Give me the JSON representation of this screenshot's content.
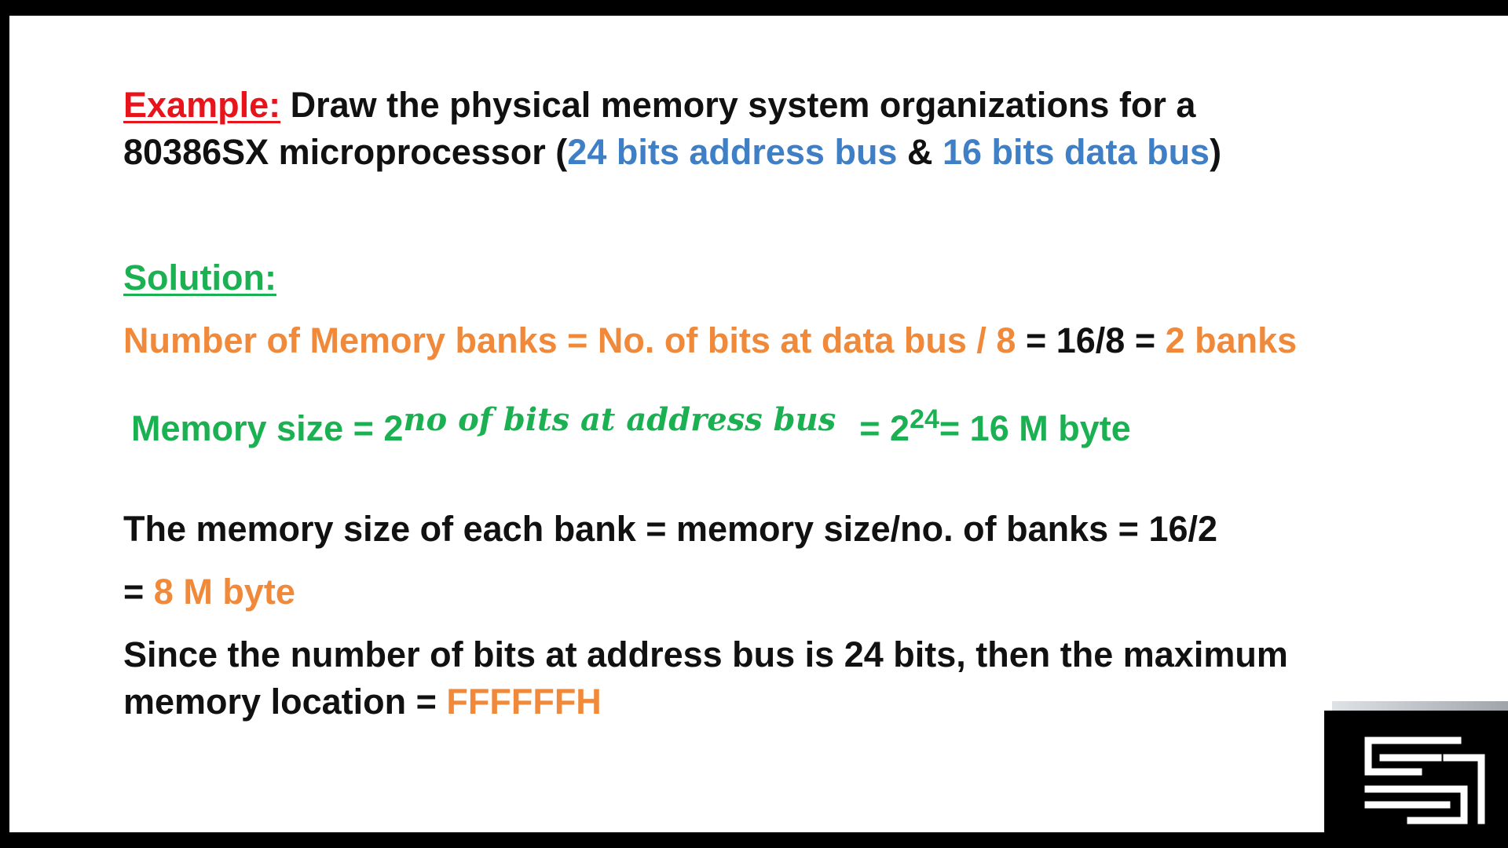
{
  "example": {
    "label": "Example:",
    "text1": " Draw the physical memory system organizations for a",
    "text2a": "80386SX microprocessor (",
    "addr_bus": "24 bits address bus",
    "amp": " & ",
    "data_bus": "16 bits data bus",
    "close": ")"
  },
  "solution": {
    "label": "Solution:",
    "banks_formula": "Number of Memory banks = No. of bits at data bus / 8",
    "banks_calc": " = 16/8 = ",
    "banks_result": "2 banks",
    "size_label": "Memory size = 2",
    "size_exponent": "no of bits at address bus",
    "size_eq": "= 2",
    "size_exp2": "24",
    "size_result": "= 16 M byte",
    "bank_size_line": "The memory size of each bank = memory size/no. of banks = 16/2",
    "bank_size_eq": "= ",
    "bank_size_result": "8 M byte",
    "max_line1": "Since the number of bits at address bus is 24 bits, then the maximum",
    "max_line2": "memory location = ",
    "max_value": "FFFFFFH"
  },
  "colors": {
    "example_label": "#e8141b",
    "bus_highlight": "#3f7fc6",
    "solution": "#1bb152",
    "result": "#f08a3a"
  },
  "logo": {
    "icon": "maze-logo-icon"
  }
}
